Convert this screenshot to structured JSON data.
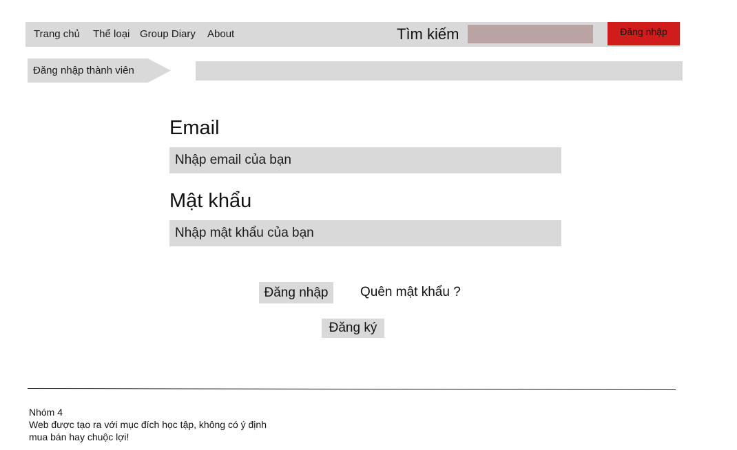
{
  "nav": {
    "links": [
      "Trang chủ",
      "Thể loại",
      "Group Diary",
      "About"
    ],
    "search_label": "Tìm kiếm",
    "search_placeholder": "",
    "login_label": "Đăng nhập"
  },
  "breadcrumb": {
    "current": "Đăng nhập thành viên"
  },
  "form": {
    "email_label": "Email",
    "email_placeholder": "Nhập email của bạn",
    "password_label": "Mật khẩu",
    "password_placeholder": "Nhập mật khẩu của bạn",
    "login_button": "Đăng nhập",
    "forgot_link": "Quên mật khẩu ?",
    "register_button": "Đăng ký"
  },
  "footer": {
    "group": "Nhóm 4",
    "line1": "Web được tạo ra với mục đích học tập, không có ý định",
    "line2": "mua bán hay chuộc lợi!"
  },
  "colors": {
    "bar_gray": "#d9d9d9",
    "search_field": "#b9a3a3",
    "login_red": "#d11c1c"
  }
}
